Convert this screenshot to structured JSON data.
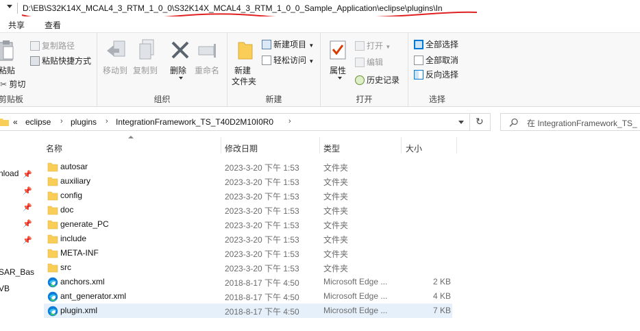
{
  "window": {
    "path_title": "D:\\EB\\S32K14X_MCAL4_3_RTM_1_0_0\\S32K14X_MCAL4_3_RTM_1_0_0_Sample_Application\\eclipse\\plugins\\In"
  },
  "menu": {
    "tabs": [
      "共享",
      "查看"
    ]
  },
  "ribbon": {
    "clipboard": {
      "paste": "粘贴",
      "copy_path": "复制路径",
      "paste_shortcut": "粘贴快捷方式",
      "cut": "剪切",
      "label": "剪贴板"
    },
    "organize": {
      "move_to": "移动到",
      "copy_to": "复制到",
      "delete": "删除",
      "rename": "重命名",
      "label": "组织"
    },
    "new": {
      "new_folder_line1": "新建",
      "new_folder_line2": "文件夹",
      "new_item": "新建项目",
      "easy_access": "轻松访问",
      "label": "新建"
    },
    "open": {
      "properties": "属性",
      "open": "打开",
      "edit": "编辑",
      "history": "历史记录",
      "label": "打开"
    },
    "select": {
      "select_all": "全部选择",
      "select_none": "全部取消",
      "invert": "反向选择",
      "label": "选择"
    }
  },
  "address": {
    "overflow": "«",
    "segments": [
      "eclipse",
      "plugins",
      "IntegrationFramework_TS_T40D2M10I0R0"
    ],
    "search_placeholder": "在 IntegrationFramework_TS_"
  },
  "nav": {
    "items": [
      "nload",
      "SAR_Bas",
      "VB"
    ]
  },
  "columns": {
    "name": "名称",
    "date": "修改日期",
    "type": "类型",
    "size": "大小"
  },
  "files": [
    {
      "name": "autosar",
      "date": "2023-3-20 下午 1:53",
      "type": "文件夹",
      "size": "",
      "icon": "folder-icon"
    },
    {
      "name": "auxiliary",
      "date": "2023-3-20 下午 1:53",
      "type": "文件夹",
      "size": "",
      "icon": "folder-icon"
    },
    {
      "name": "config",
      "date": "2023-3-20 下午 1:53",
      "type": "文件夹",
      "size": "",
      "icon": "folder-icon"
    },
    {
      "name": "doc",
      "date": "2023-3-20 下午 1:53",
      "type": "文件夹",
      "size": "",
      "icon": "folder-icon"
    },
    {
      "name": "generate_PC",
      "date": "2023-3-20 下午 1:53",
      "type": "文件夹",
      "size": "",
      "icon": "folder-icon"
    },
    {
      "name": "include",
      "date": "2023-3-20 下午 1:53",
      "type": "文件夹",
      "size": "",
      "icon": "folder-icon"
    },
    {
      "name": "META-INF",
      "date": "2023-3-20 下午 1:53",
      "type": "文件夹",
      "size": "",
      "icon": "folder-icon"
    },
    {
      "name": "src",
      "date": "2023-3-20 下午 1:53",
      "type": "文件夹",
      "size": "",
      "icon": "folder-icon"
    },
    {
      "name": "anchors.xml",
      "date": "2018-8-17 下午 4:50",
      "type": "Microsoft Edge ...",
      "size": "2 KB",
      "icon": "edge-icon"
    },
    {
      "name": "ant_generator.xml",
      "date": "2018-8-17 下午 4:50",
      "type": "Microsoft Edge ...",
      "size": "4 KB",
      "icon": "edge-icon"
    },
    {
      "name": "plugin.xml",
      "date": "2018-8-17 下午 4:50",
      "type": "Microsoft Edge ...",
      "size": "7 KB",
      "icon": "edge-icon"
    }
  ],
  "selected_file": "plugin.xml",
  "colors": {
    "selection": "#e5f0fb",
    "folder": "#f8cd58",
    "accent": "#0078d7",
    "annotation": "#e02020"
  }
}
